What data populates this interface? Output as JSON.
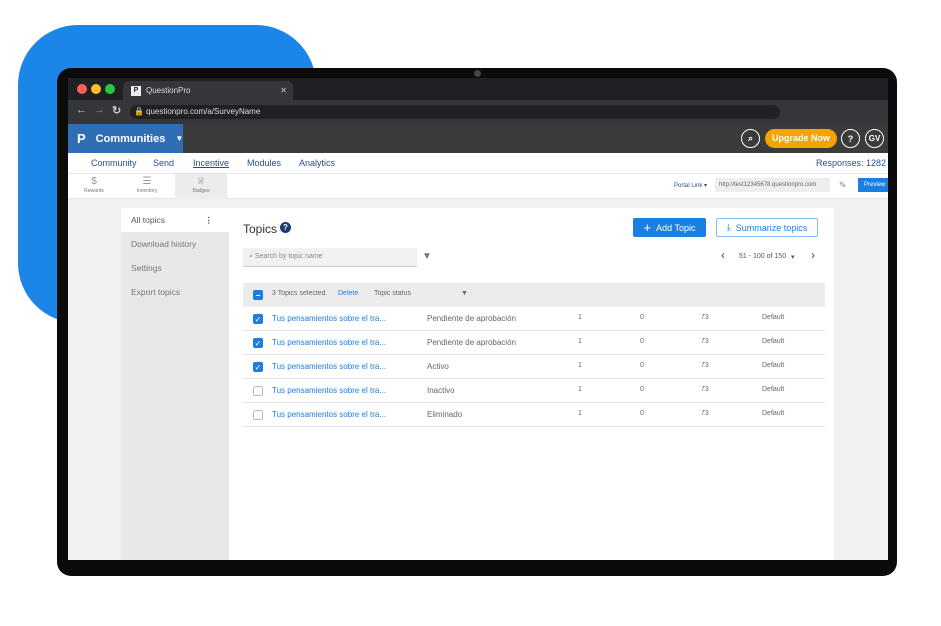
{
  "browser": {
    "tab_title": "QuestionPro",
    "url": "questionpro.com/a/SurveyName"
  },
  "header": {
    "brand": "Communities",
    "upgrade": "Upgrade Now",
    "help": "?",
    "avatar": "GV"
  },
  "nav": {
    "items": [
      "Community",
      "Send",
      "Incentive",
      "Modules",
      "Analytics"
    ],
    "responses": "Responses: 1282"
  },
  "subnav": {
    "items": [
      "Rewards",
      "Inventory",
      "Badges"
    ],
    "portal_link": "Portal Link",
    "portal_url": "http://test12345678.questionpro.com",
    "preview": "Preview"
  },
  "sidebar": {
    "items": [
      "All topics",
      "Download history",
      "Settings",
      "Export topics"
    ]
  },
  "main": {
    "title": "Topics",
    "add_topic": "Add Topic",
    "summarize": "Summarize topics",
    "search_placeholder": "Search by topic name",
    "pagination": "51 - 100 of 150",
    "bulk": {
      "selected": "3 Topics selected",
      "delete": "Delete",
      "status": "Topic status"
    },
    "rows": [
      {
        "checked": true,
        "name": "Tus pensamientos sobre el tra...",
        "status": "Pendiente de aprobación",
        "c1": "1",
        "c2": "0",
        "c3": "73",
        "type": "Default"
      },
      {
        "checked": true,
        "name": "Tus pensamientos sobre el tra...",
        "status": "Pendiente de aprobación",
        "c1": "1",
        "c2": "0",
        "c3": "73",
        "type": "Default"
      },
      {
        "checked": true,
        "name": "Tus pensamientos sobre el tra...",
        "status": "Activo",
        "c1": "1",
        "c2": "0",
        "c3": "73",
        "type": "Default"
      },
      {
        "checked": false,
        "name": "Tus pensamientos sobre el tra...",
        "status": "Inactivo",
        "c1": "1",
        "c2": "0",
        "c3": "73",
        "type": "Default"
      },
      {
        "checked": false,
        "name": "Tus pensamientos sobre el tra...",
        "status": "Eliminado",
        "c1": "1",
        "c2": "0",
        "c3": "73",
        "type": "Default"
      }
    ]
  }
}
